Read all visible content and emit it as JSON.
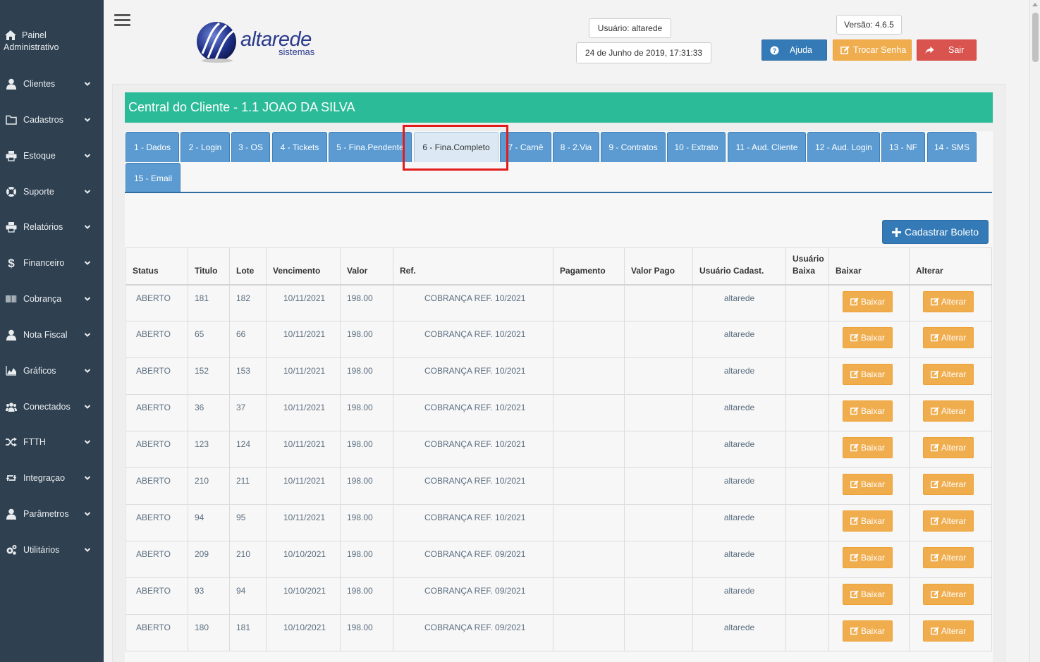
{
  "sidebar": {
    "admin": {
      "line1": "Painel",
      "line2": "Administrativo",
      "icon": "home-icon"
    },
    "items": [
      {
        "label": "Clientes",
        "icon": "user-icon"
      },
      {
        "label": "Cadastros",
        "icon": "folder-icon"
      },
      {
        "label": "Estoque",
        "icon": "print-icon"
      },
      {
        "label": "Suporte",
        "icon": "life-ring-icon"
      },
      {
        "label": "Relatórios",
        "icon": "print-icon"
      },
      {
        "label": "Financeiro",
        "icon": "dollar-icon"
      },
      {
        "label": "Cobrança",
        "icon": "barcode-icon"
      },
      {
        "label": "Nota Fiscal",
        "icon": "user-icon"
      },
      {
        "label": "Gráficos",
        "icon": "area-chart-icon"
      },
      {
        "label": "Conectados",
        "icon": "users-icon"
      },
      {
        "label": "FTTH",
        "icon": "random-icon"
      },
      {
        "label": "Integraçao",
        "icon": "retweet-icon"
      },
      {
        "label": "Parâmetros",
        "icon": "user-icon"
      },
      {
        "label": "Utilitários",
        "icon": "cogs-icon"
      }
    ]
  },
  "header": {
    "logo_text": "altarede",
    "logo_sub": "sistemas",
    "user": "Usuário: altarede",
    "datetime": "24 de Junho de 2019, 17:31:33",
    "version": "Versão: 4.6.5",
    "help_label": "Ajuda",
    "change_password_label": "Trocar Senha",
    "logout_label": "Sair",
    "colors": {
      "help": "#337ab7",
      "change_password": "#f0ad4e",
      "logout": "#d9534f"
    }
  },
  "main": {
    "title": "Central do Cliente - 1.1 JOAO DA SILVA",
    "title_color": "#2bbb98",
    "tabs": [
      "1 - Dados",
      "2 - Login",
      "3 - OS",
      "4 - Tickets",
      "5 - Fina.Pendente",
      "6 - Fina.Completo",
      "7 - Carnê",
      "8 - 2.Via",
      "9 - Contratos",
      "10 - Extrato",
      "11 - Aud. Cliente",
      "12 - Aud. Login",
      "13 - NF",
      "14 - SMS",
      "15 - Email"
    ],
    "active_tab": "6 - Fina.Completo",
    "add_button_label": "Cadastrar Boleto",
    "table": {
      "headers": {
        "status": "Status",
        "titulo": "Titulo",
        "lote": "Lote",
        "vencimento": "Vencimento",
        "valor": "Valor",
        "ref": "Ref.",
        "pagamento": "Pagamento",
        "valor_pago": "Valor Pago",
        "usuario_cadast": "Usuário Cadast.",
        "usuario_baixa_1": "Usuário",
        "usuario_baixa_2": "Baixa",
        "baixar": "Baixar",
        "alterar": "Alterar"
      },
      "baixar_label": "Baixar",
      "alterar_label": "Alterar",
      "rows": [
        {
          "status": "ABERTO",
          "titulo": "181",
          "lote": "182",
          "vencimento": "10/11/2021",
          "valor": "198.00",
          "ref": "COBRANÇA REF. 10/2021",
          "pagamento": "",
          "valor_pago": "",
          "usuario": "altarede",
          "usuario_baixa": ""
        },
        {
          "status": "ABERTO",
          "titulo": "65",
          "lote": "66",
          "vencimento": "10/11/2021",
          "valor": "198.00",
          "ref": "COBRANÇA REF. 10/2021",
          "pagamento": "",
          "valor_pago": "",
          "usuario": "altarede",
          "usuario_baixa": ""
        },
        {
          "status": "ABERTO",
          "titulo": "152",
          "lote": "153",
          "vencimento": "10/11/2021",
          "valor": "198.00",
          "ref": "COBRANÇA REF. 10/2021",
          "pagamento": "",
          "valor_pago": "",
          "usuario": "altarede",
          "usuario_baixa": ""
        },
        {
          "status": "ABERTO",
          "titulo": "36",
          "lote": "37",
          "vencimento": "10/11/2021",
          "valor": "198.00",
          "ref": "COBRANÇA REF. 10/2021",
          "pagamento": "",
          "valor_pago": "",
          "usuario": "altarede",
          "usuario_baixa": ""
        },
        {
          "status": "ABERTO",
          "titulo": "123",
          "lote": "124",
          "vencimento": "10/11/2021",
          "valor": "198.00",
          "ref": "COBRANÇA REF. 10/2021",
          "pagamento": "",
          "valor_pago": "",
          "usuario": "altarede",
          "usuario_baixa": ""
        },
        {
          "status": "ABERTO",
          "titulo": "210",
          "lote": "211",
          "vencimento": "10/11/2021",
          "valor": "198.00",
          "ref": "COBRANÇA REF. 10/2021",
          "pagamento": "",
          "valor_pago": "",
          "usuario": "altarede",
          "usuario_baixa": ""
        },
        {
          "status": "ABERTO",
          "titulo": "94",
          "lote": "95",
          "vencimento": "10/11/2021",
          "valor": "198.00",
          "ref": "COBRANÇA REF. 10/2021",
          "pagamento": "",
          "valor_pago": "",
          "usuario": "altarede",
          "usuario_baixa": ""
        },
        {
          "status": "ABERTO",
          "titulo": "209",
          "lote": "210",
          "vencimento": "10/10/2021",
          "valor": "198.00",
          "ref": "COBRANÇA REF. 09/2021",
          "pagamento": "",
          "valor_pago": "",
          "usuario": "altarede",
          "usuario_baixa": ""
        },
        {
          "status": "ABERTO",
          "titulo": "93",
          "lote": "94",
          "vencimento": "10/10/2021",
          "valor": "198.00",
          "ref": "COBRANÇA REF. 09/2021",
          "pagamento": "",
          "valor_pago": "",
          "usuario": "altarede",
          "usuario_baixa": ""
        },
        {
          "status": "ABERTO",
          "titulo": "180",
          "lote": "181",
          "vencimento": "10/10/2021",
          "valor": "198.00",
          "ref": "COBRANÇA REF. 09/2021",
          "pagamento": "",
          "valor_pago": "",
          "usuario": "altarede",
          "usuario_baixa": ""
        }
      ]
    }
  }
}
